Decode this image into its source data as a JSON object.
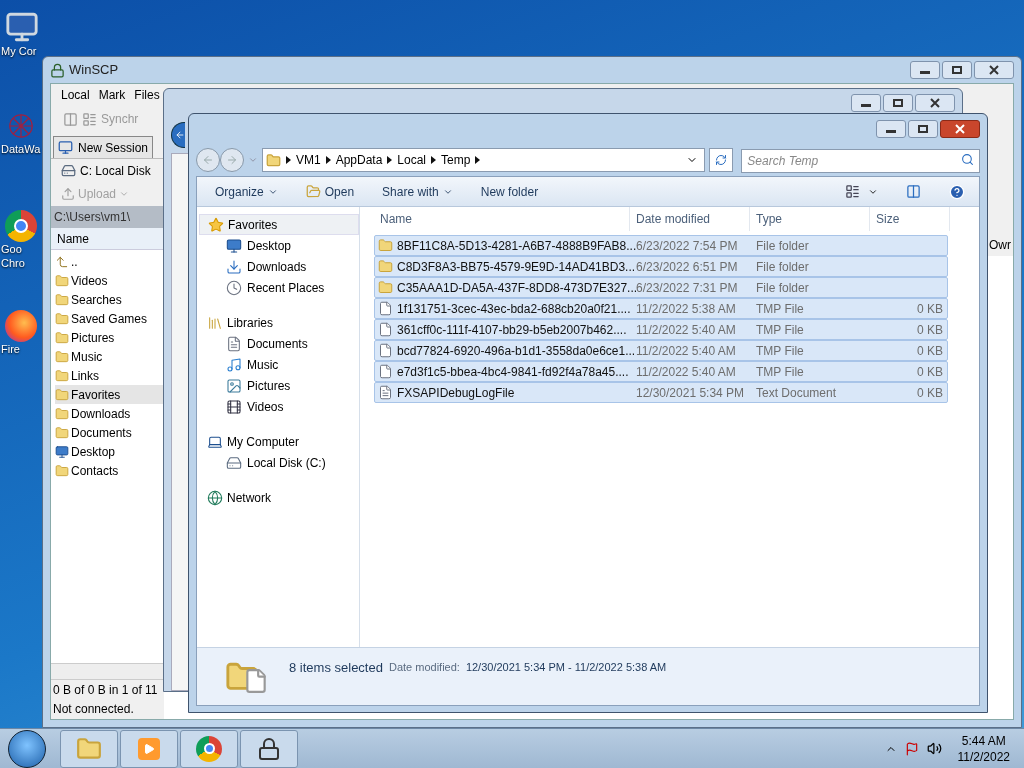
{
  "desktop_icons": [
    {
      "kind": "computer",
      "lines": [
        "My Cor"
      ]
    },
    {
      "kind": "network-app",
      "lines": [
        "DataWa"
      ]
    },
    {
      "kind": "chrome",
      "lines": [
        "Goo",
        "Chro"
      ]
    },
    {
      "kind": "firefox",
      "lines": [
        "Fire"
      ]
    }
  ],
  "winscp": {
    "title": "WinSCP",
    "menu": [
      "Local",
      "Mark",
      "Files"
    ],
    "toolbar_text": "Synchr",
    "session_tab": "New Session",
    "drive": "C: Local Disk",
    "upload": {
      "label": "Upload",
      "disabled": true
    },
    "path": "C:\\Users\\vm1\\",
    "column": "Name",
    "right_column": "Owr",
    "items": [
      {
        "name": "..",
        "kind": "up",
        "selected": false
      },
      {
        "name": "Videos",
        "kind": "folder",
        "selected": false
      },
      {
        "name": "Searches",
        "kind": "folder",
        "selected": false
      },
      {
        "name": "Saved Games",
        "kind": "folder",
        "selected": false
      },
      {
        "name": "Pictures",
        "kind": "folder",
        "selected": false
      },
      {
        "name": "Music",
        "kind": "folder",
        "selected": false
      },
      {
        "name": "Links",
        "kind": "folder",
        "selected": false
      },
      {
        "name": "Favorites",
        "kind": "folder",
        "selected": true
      },
      {
        "name": "Downloads",
        "kind": "folder",
        "selected": false
      },
      {
        "name": "Documents",
        "kind": "folder",
        "selected": false
      },
      {
        "name": "Desktop",
        "kind": "desktop",
        "selected": false
      },
      {
        "name": "Contacts",
        "kind": "folder",
        "selected": false
      }
    ],
    "status": [
      "0 B of 0 B in 1 of 11",
      "Not connected."
    ]
  },
  "explorer": {
    "breadcrumbs": [
      "VM1",
      "AppData",
      "Local",
      "Temp"
    ],
    "search_placeholder": "Search Temp",
    "commands": [
      {
        "label": "Organize",
        "kind": "menu"
      },
      {
        "label": "Open",
        "kind": "open"
      },
      {
        "label": "Share with",
        "kind": "menu"
      },
      {
        "label": "New folder",
        "kind": "plain"
      }
    ],
    "nav": [
      {
        "label": "Favorites",
        "kind": "star",
        "children": [
          {
            "label": "Desktop",
            "kind": "desktop"
          },
          {
            "label": "Downloads",
            "kind": "download"
          },
          {
            "label": "Recent Places",
            "kind": "recent"
          }
        ]
      },
      {
        "label": "Libraries",
        "kind": "library",
        "children": [
          {
            "label": "Documents",
            "kind": "document"
          },
          {
            "label": "Music",
            "kind": "music"
          },
          {
            "label": "Pictures",
            "kind": "picture"
          },
          {
            "label": "Videos",
            "kind": "video"
          }
        ]
      },
      {
        "label": "My Computer",
        "kind": "computer",
        "children": [
          {
            "label": "Local Disk (C:)",
            "kind": "disk"
          }
        ]
      },
      {
        "label": "Network",
        "kind": "network"
      }
    ],
    "columns": [
      "Name",
      "Date modified",
      "Type",
      "Size"
    ],
    "files": [
      {
        "name": "8BF11C8A-5D13-4281-A6B7-4888B9FAB8...",
        "date": "6/23/2022 7:54 PM",
        "type": "File folder",
        "kind": "folder",
        "selected": true
      },
      {
        "name": "C8D3F8A3-BB75-4579-9E9D-14AD41BD3...",
        "date": "6/23/2022 6:51 PM",
        "type": "File folder",
        "kind": "folder",
        "selected": true
      },
      {
        "name": "C35AAA1D-DA5A-437F-8DD8-473D7E327...",
        "date": "6/23/2022 7:31 PM",
        "type": "File folder",
        "kind": "folder",
        "selected": true
      },
      {
        "name": "1f131751-3cec-43ec-bda2-688cb20a0f21....",
        "date": "11/2/2022 5:38 AM",
        "type": "TMP File",
        "size": "0 KB",
        "kind": "file",
        "selected": true
      },
      {
        "name": "361cff0c-111f-4107-bb29-b5eb2007b462....",
        "date": "11/2/2022 5:40 AM",
        "type": "TMP File",
        "size": "0 KB",
        "kind": "file",
        "selected": true
      },
      {
        "name": "bcd77824-6920-496a-b1d1-3558da0e6ce1...",
        "date": "11/2/2022 5:40 AM",
        "type": "TMP File",
        "size": "0 KB",
        "kind": "file",
        "selected": true
      },
      {
        "name": "e7d3f1c5-bbea-4bc4-9841-fd92f4a78a45....",
        "date": "11/2/2022 5:40 AM",
        "type": "TMP File",
        "size": "0 KB",
        "kind": "file",
        "selected": true
      },
      {
        "name": "FXSAPIDebugLogFile",
        "date": "12/30/2021 5:34 PM",
        "type": "Text Document",
        "size": "0 KB",
        "kind": "text",
        "selected": true
      }
    ],
    "details": {
      "count": "8 items selected",
      "label": "Date modified:",
      "value": "12/30/2021 5:34 PM - 11/2/2022 5:38 AM"
    }
  },
  "taskbar": {
    "apps": [
      {
        "kind": "explorer"
      },
      {
        "kind": "media"
      },
      {
        "kind": "chrome"
      },
      {
        "kind": "winscp"
      }
    ],
    "time": "5:44 AM",
    "date": "11/2/2022"
  }
}
